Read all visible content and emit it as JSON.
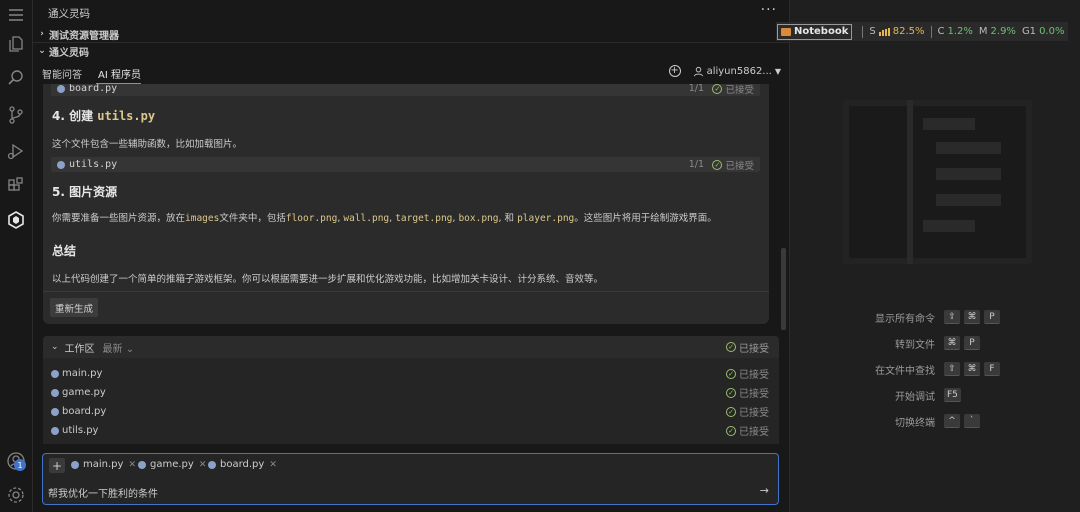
{
  "activity_bar": {
    "icons": [
      "menu-icon",
      "files-icon",
      "search-icon",
      "source-control-icon",
      "run-debug-icon",
      "extensions-icon",
      "tongyi-icon"
    ],
    "bottom_icons": [
      "account-icon",
      "settings-icon"
    ],
    "account_badge": "1"
  },
  "sidebar": {
    "title": "通义灵码",
    "more": "···",
    "sections": [
      "测试资源管理器",
      "通义灵码"
    ],
    "tabs": [
      "智能问答",
      "AI 程序员"
    ],
    "active_tab": "AI 程序员",
    "user": "aliyun5862..."
  },
  "chat": {
    "top_file": {
      "name": "board.py",
      "count": "1/1",
      "status": "已接受"
    },
    "step4_prefix": "4. 创建 ",
    "step4_code": "utils.py",
    "step4_desc": "这个文件包含一些辅助函数，比如加载图片。",
    "utils_file": {
      "name": "utils.py",
      "count": "1/1",
      "status": "已接受"
    },
    "step5": "5. 图片资源",
    "step5_desc": {
      "p1": "你需要准备一些图片资源，放在",
      "c1": "images",
      "p2": "文件夹中，包括",
      "c2": "floor.png",
      "s1": ", ",
      "c3": "wall.png",
      "s2": ", ",
      "c4": "target.png",
      "s3": ", ",
      "c5": "box.png",
      "s4": ", 和 ",
      "c6": "player.png",
      "p3": "。这些图片将用于绘制游戏界面。"
    },
    "summary_title": "总结",
    "summary_text": "以上代码创建了一个简单的推箱子游戏框架。你可以根据需要进一步扩展和优化游戏功能，比如增加关卡设计、计分系统、音效等。",
    "regenerate": "重新生成"
  },
  "workspace": {
    "title": "工作区",
    "latest": "最新",
    "status_all": "已接受",
    "files": [
      {
        "name": "main.py",
        "status": "已接受"
      },
      {
        "name": "game.py",
        "status": "已接受"
      },
      {
        "name": "board.py",
        "status": "已接受"
      },
      {
        "name": "utils.py",
        "status": "已接受"
      }
    ]
  },
  "input": {
    "chips": [
      "main.py",
      "game.py",
      "board.py"
    ],
    "text": "帮我优化一下胜利的条件",
    "send": "→"
  },
  "statusbar": {
    "notebook": "Notebook",
    "s_label": "S",
    "s_value": "82.5%",
    "c_label": "C",
    "c_value": "1.2%",
    "m_label": "M",
    "m_value": "2.9%",
    "g_label": "G1",
    "g_value": "0.0%"
  },
  "commands": [
    {
      "label": "显示所有命令",
      "keys": [
        "⇧",
        "⌘",
        "P"
      ]
    },
    {
      "label": "转到文件",
      "keys": [
        "⌘",
        "P"
      ]
    },
    {
      "label": "在文件中查找",
      "keys": [
        "⇧",
        "⌘",
        "F"
      ]
    },
    {
      "label": "开始调试",
      "keys": [
        "F5"
      ]
    },
    {
      "label": "切换终端",
      "keys": [
        "^",
        "`"
      ]
    }
  ],
  "colors": {
    "accent": "#3f74c8",
    "accepted": "#9bbf6b",
    "code": "#dcc88a",
    "s_value": "#e6b450",
    "c_value": "#6fbf73"
  }
}
